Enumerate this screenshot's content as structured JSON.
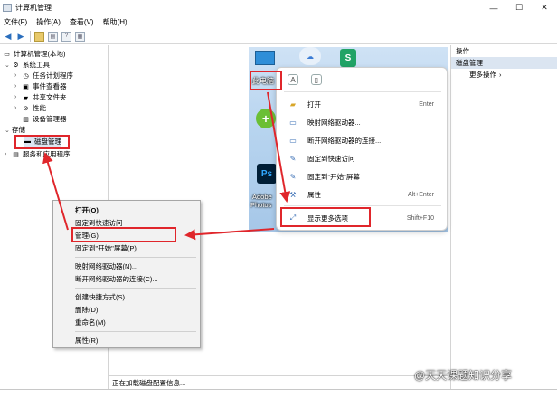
{
  "window": {
    "title": "计算机管理",
    "controls": [
      "—",
      "☐",
      "✕"
    ]
  },
  "menu": [
    "文件(F)",
    "操作(A)",
    "查看(V)",
    "帮助(H)"
  ],
  "tree": {
    "root": "计算机管理(本地)",
    "system_tools": "系统工具",
    "task_scheduler": "任务计划程序",
    "event_viewer": "事件查看器",
    "shared_folders": "共享文件夹",
    "performance": "性能",
    "device_manager": "设备管理器",
    "storage": "存储",
    "disk_management": "磁盘管理",
    "services_apps": "服务和应用程序"
  },
  "actions": {
    "header": "操作",
    "section": "磁盘管理",
    "more": "更多操作"
  },
  "status": "正在加载磁盘配置信息...",
  "desktop": {
    "this_pc": "此电脑",
    "adobe": "Adobe",
    "photos": "Photos",
    "ps": "Ps",
    "s_icon": "S"
  },
  "ctx11": {
    "items": [
      {
        "label": "打开",
        "shortcut": "Enter"
      },
      {
        "label": "映射网络驱动器...",
        "shortcut": ""
      },
      {
        "label": "断开网络驱动器的连接...",
        "shortcut": ""
      },
      {
        "label": "固定到快速访问",
        "shortcut": ""
      },
      {
        "label": "固定到\"开始\"屏幕",
        "shortcut": ""
      },
      {
        "label": "属性",
        "shortcut": "Alt+Enter"
      },
      {
        "label": "显示更多选项",
        "shortcut": "Shift+F10"
      }
    ]
  },
  "ctx_classic": {
    "items": [
      "打开(O)",
      "固定到快速访问",
      "管理(G)",
      "固定到\"开始\"屏幕(P)",
      "映射网络驱动器(N)...",
      "断开网络驱动器的连接(C)...",
      "创建快捷方式(S)",
      "删除(D)",
      "重命名(M)",
      "属性(R)"
    ]
  },
  "watermark": "@天天课题知识分享",
  "colors": {
    "highlight_red": "#e0262b",
    "selection_blue": "#dbe5f1"
  }
}
